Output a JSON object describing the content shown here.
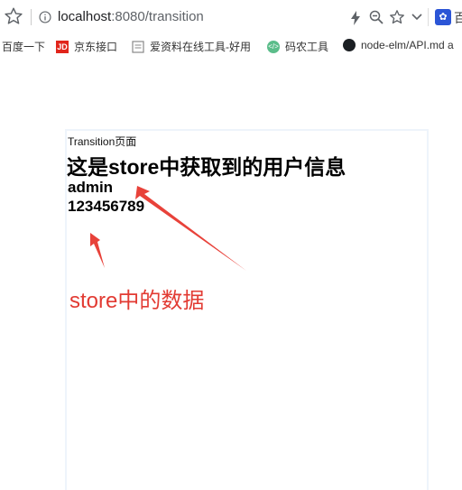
{
  "address_bar": {
    "host": "localhost",
    "port_path": ":8080/transition",
    "extension_label": "百"
  },
  "bookmarks": [
    {
      "label": "百度一下",
      "icon": "none"
    },
    {
      "label": "京东接口",
      "icon": "jd-logo-icon"
    },
    {
      "label": "爱资料在线工具-好用",
      "icon": "page-icon"
    },
    {
      "label": "码农工具",
      "icon": "code-icon"
    },
    {
      "label": "node-elm/API.md a",
      "icon": "github-icon"
    }
  ],
  "content": {
    "page_label": "Transition页面",
    "heading": "这是store中获取到的用户信息",
    "username": "admin",
    "password": "123456789"
  },
  "annotation": {
    "text": "store中的数据",
    "color": "#e23b33"
  },
  "colors": {
    "accent_red": "#e23b33",
    "jd_red": "#e1251b",
    "card_border": "#eef4fb"
  }
}
